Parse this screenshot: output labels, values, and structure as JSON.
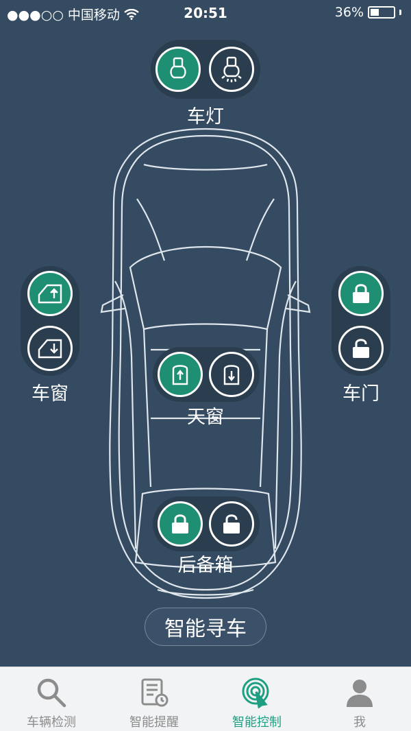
{
  "status_bar": {
    "carrier": "●●●○○ 中国移动",
    "time": "20:51",
    "battery_text": "36%",
    "battery_level": 0.36
  },
  "controls": {
    "lights": {
      "label": "车灯"
    },
    "windows": {
      "label": "车窗"
    },
    "doors": {
      "label": "车门"
    },
    "sunroof": {
      "label": "天窗"
    },
    "trunk": {
      "label": "后备箱"
    }
  },
  "find_car_button": "智能寻车",
  "tabs": [
    {
      "label": "车辆检测",
      "icon": "search-icon",
      "active": false
    },
    {
      "label": "智能提醒",
      "icon": "reminder-icon",
      "active": false
    },
    {
      "label": "智能控制",
      "icon": "touch-control-icon",
      "active": true
    },
    {
      "label": "我",
      "icon": "user-icon",
      "active": false
    }
  ],
  "colors": {
    "background": "#344b61",
    "active_green": "#1f8f73",
    "tab_active": "#1f9f82"
  }
}
